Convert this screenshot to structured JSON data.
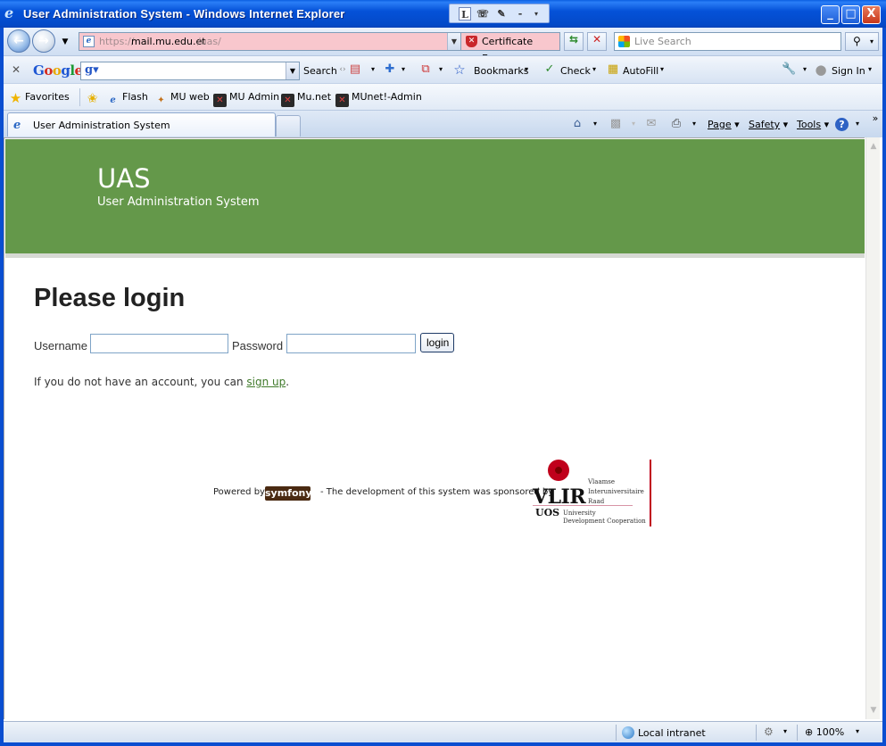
{
  "window": {
    "title": "User Administration System - Windows Internet Explorer",
    "minimize": "_",
    "maximize": "□",
    "close": "X"
  },
  "langbar": {
    "l": "L"
  },
  "address": {
    "url_prefix": "https://",
    "url_host": "mail.mu.edu.et",
    "url_path": "/uas/",
    "cert_error": "Certificate Error",
    "search_placeholder": "Live Search"
  },
  "google_toolbar": {
    "search_label": "Search",
    "bookmarks_label": "Bookmarks",
    "check_label": "Check",
    "autofill_label": "AutoFill",
    "signin_label": "Sign In"
  },
  "favorites": {
    "favorites_label": "Favorites",
    "items": [
      {
        "label": "Flash"
      },
      {
        "label": "MU web"
      },
      {
        "label": "MU Admin"
      },
      {
        "label": "Mu.net"
      },
      {
        "label": "MUnet!-Admin"
      }
    ]
  },
  "tabs": {
    "active_label": "User Administration System"
  },
  "command_bar": {
    "page_label": "Page",
    "safety_label": "Safety",
    "tools_label": "Tools"
  },
  "page": {
    "brand": "UAS",
    "brand_subtitle": "User Administration System",
    "heading": "Please login",
    "username_label": "Username",
    "password_label": "Password",
    "login_button": "login",
    "signup_prefix": "If you do not have an account, you can ",
    "signup_link": "sign up",
    "signup_suffix": ".",
    "powered_by": "Powered by",
    "symfony": "symfony",
    "sponsor_text": "-  The development of this system was sponsored by",
    "vlir": {
      "name": "VLIR",
      "uos": "UOS",
      "line1": "Vlaamse",
      "line2": "Interuniversitaire",
      "line3": "Raad",
      "line4": "University",
      "line5": "Development Cooperation"
    }
  },
  "status": {
    "zone": "Local intranet",
    "zoom": "100%"
  }
}
